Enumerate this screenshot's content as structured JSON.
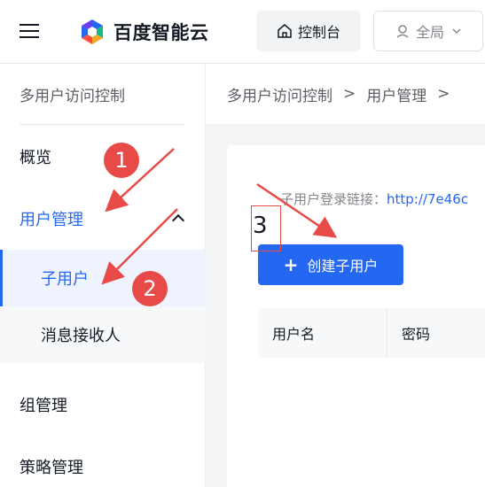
{
  "header": {
    "logo_text": "百度智能云",
    "console_label": "控制台",
    "region_label": "全局",
    "brand_colors": [
      "#2468f2",
      "#ff4d3a",
      "#12b886",
      "#f5a623"
    ]
  },
  "sidebar": {
    "title": "多用户访问控制",
    "items": [
      {
        "label": "概览"
      },
      {
        "label": "用户管理"
      },
      {
        "label": "组管理"
      },
      {
        "label": "策略管理"
      }
    ],
    "subitems": [
      {
        "label": "子用户"
      },
      {
        "label": "消息接收人"
      }
    ]
  },
  "main": {
    "breadcrumb": [
      "多用户访问控制",
      "用户管理"
    ],
    "login_link_label": "子用户登录链接：",
    "login_link_url": "http://7e46c",
    "create_button_label": "创建子用户",
    "table_columns": [
      "用户名",
      "密码"
    ]
  },
  "annotations": {
    "badges": [
      "1",
      "2"
    ],
    "box_number": "3",
    "color": "#e84a47"
  }
}
